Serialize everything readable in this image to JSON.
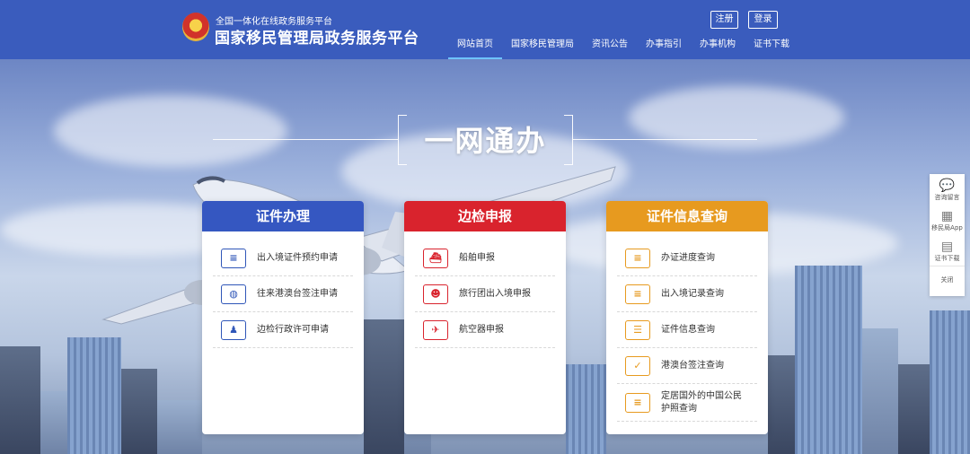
{
  "header": {
    "subtitle": "全国一体化在线政务服务平台",
    "title": "国家移民管理局政务服务平台",
    "register_label": "注册",
    "login_label": "登录",
    "nav": [
      {
        "label": "网站首页"
      },
      {
        "label": "国家移民管理局"
      },
      {
        "label": "资讯公告"
      },
      {
        "label": "办事指引"
      },
      {
        "label": "办事机构"
      },
      {
        "label": "证书下载"
      }
    ]
  },
  "hero": {
    "slogan": "一网通办"
  },
  "cards": [
    {
      "title": "证件办理",
      "color": "#3557c1",
      "icon_color": "#2f56b8",
      "items": [
        {
          "label": "出入境证件预约申请",
          "icon": "card-clock-icon"
        },
        {
          "label": "往来港澳台签注申请",
          "icon": "globe-icon"
        },
        {
          "label": "边检行政许可申请",
          "icon": "person-document-icon"
        }
      ]
    },
    {
      "title": "边检申报",
      "color": "#d9232d",
      "icon_color": "#d9232d",
      "items": [
        {
          "label": "船舶申报",
          "icon": "ship-icon"
        },
        {
          "label": "旅行团出入境申报",
          "icon": "group-icon"
        },
        {
          "label": "航空器申报",
          "icon": "airplane-icon"
        }
      ]
    },
    {
      "title": "证件信息查询",
      "color": "#e79a1f",
      "icon_color": "#e79a1f",
      "items": [
        {
          "label": "办证进度查询",
          "icon": "search-doc-icon"
        },
        {
          "label": "出入境记录查询",
          "icon": "search-record-icon"
        },
        {
          "label": "证件信息查询",
          "icon": "id-card-icon"
        },
        {
          "label": "港澳台签注查询",
          "icon": "checklist-icon"
        },
        {
          "label": "定居国外的中国公民护照查询",
          "icon": "passport-icon"
        }
      ]
    }
  ],
  "floatbar": {
    "items": [
      {
        "label": "咨询留言",
        "icon": "chat-icon"
      },
      {
        "label": "移民局App",
        "icon": "qrcode-icon"
      },
      {
        "label": "证书下载",
        "icon": "certificate-icon"
      }
    ],
    "close_label": "关闭"
  }
}
